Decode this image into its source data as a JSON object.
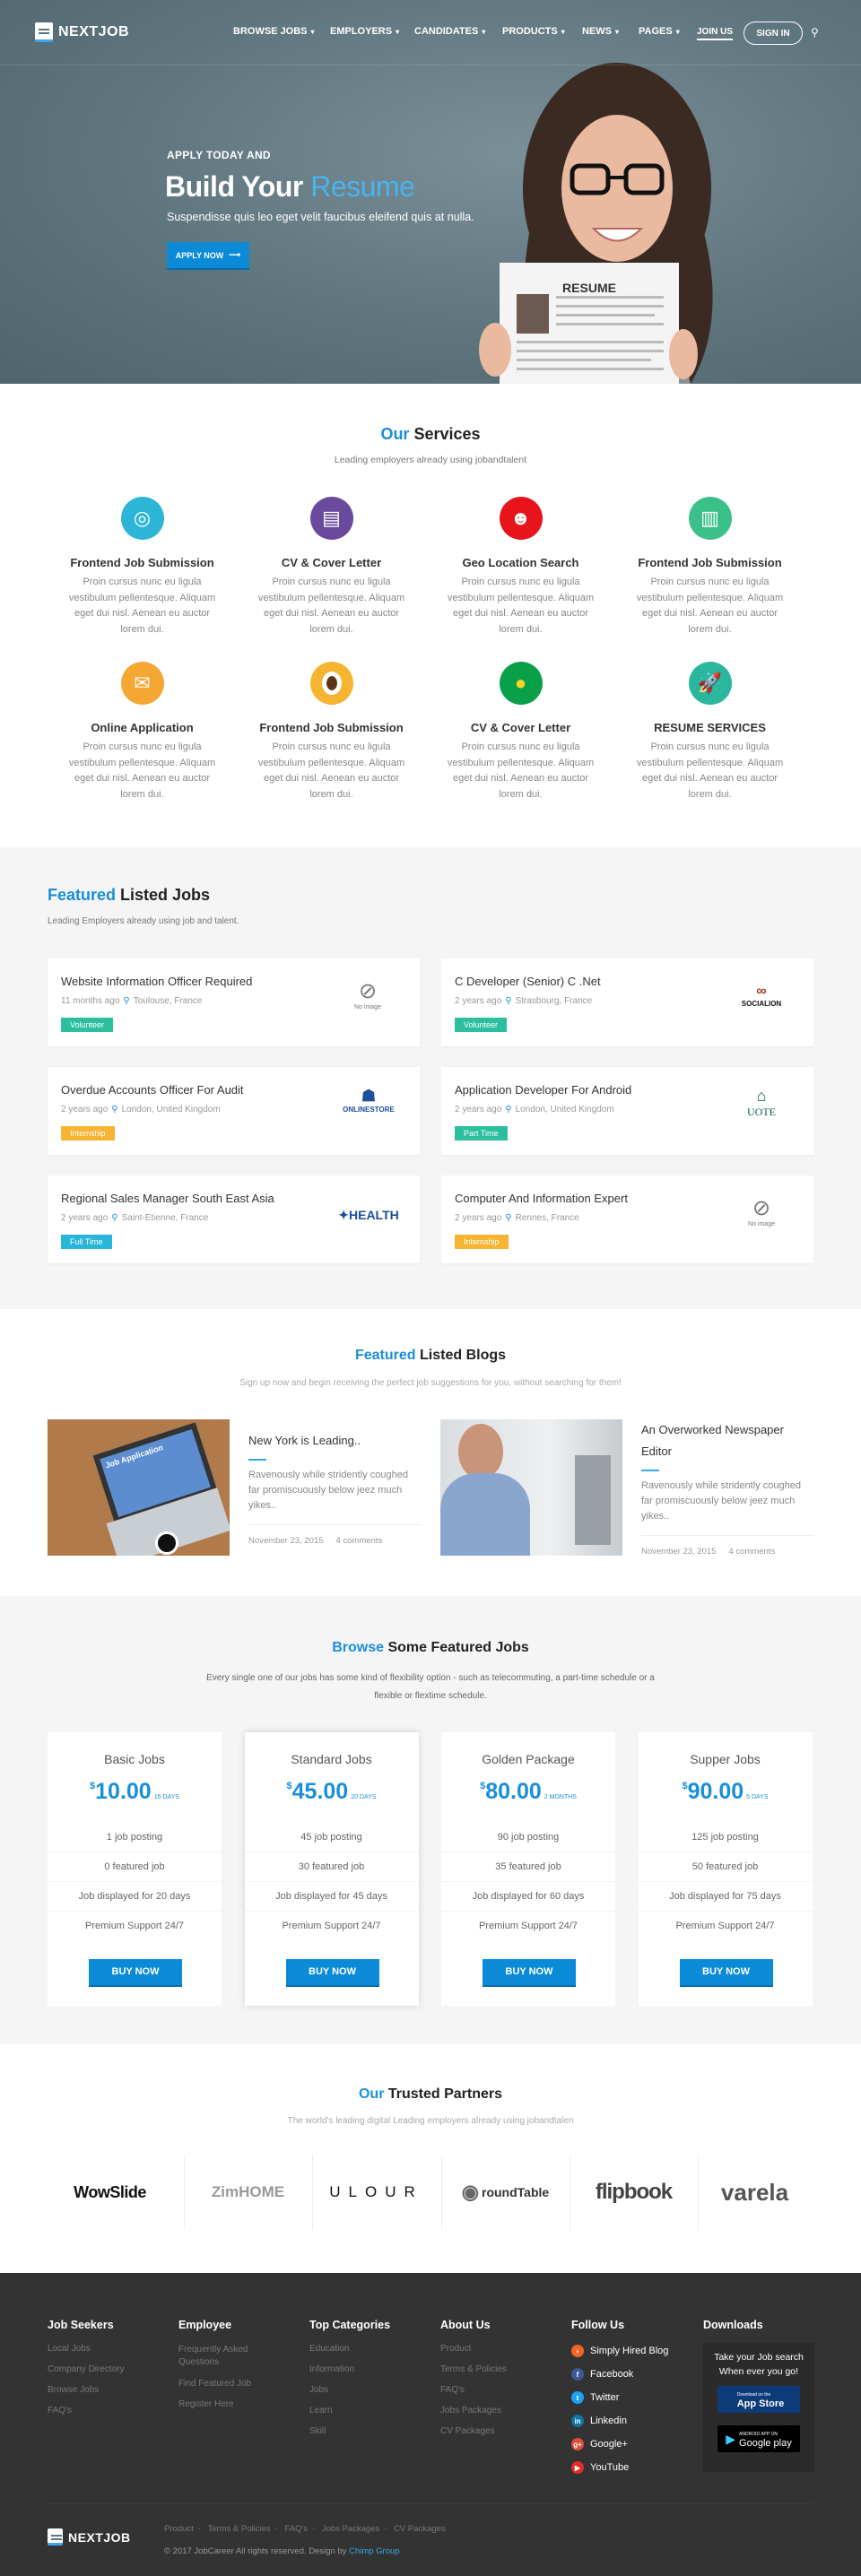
{
  "colors": {
    "accent": "#1a8fd9",
    "button": "#0b8ad8",
    "footer_bg": "#333333",
    "section_grey": "#f5f5f5"
  },
  "header": {
    "logo": "NEXTJOB",
    "nav": [
      {
        "label": "BROWSE JOBS"
      },
      {
        "label": "EMPLOYERS"
      },
      {
        "label": "CANDIDATES"
      },
      {
        "label": "PRODUCTS"
      },
      {
        "label": "NEWS"
      },
      {
        "label": "PAGES"
      }
    ],
    "join_us": "JOIN US",
    "sign_in": "SIGN IN",
    "search_icon": "search-icon"
  },
  "hero": {
    "kicker": "APPLY TODAY AND",
    "title_plain": "Build Your",
    "title_accent": "Resume",
    "subtitle": "Suspendisse quis leo eget velit faucibus eleifend quis at nulla.",
    "button": "APPLY NOW",
    "resume_label": "RESUME"
  },
  "services": {
    "title_accent": "Our",
    "title_rest": "Services",
    "subtitle": "Leading employers already using jobandtalent",
    "items": [
      {
        "name": "Frontend Job Submission",
        "text": "Proin cursus nunc eu ligula vestibulum pellentesque. Aliquam eget dui nisl. Aenean eu auctor lorem dui.",
        "icon": "target-icon",
        "color": "#2cb5d7"
      },
      {
        "name": "CV & Cover Letter",
        "text": "Proin cursus nunc eu ligula vestibulum pellentesque. Aliquam eget dui nisl. Aenean eu auctor lorem dui.",
        "icon": "chart-document-icon",
        "color": "#6a4a9c"
      },
      {
        "name": "Geo Location Search",
        "text": "Proin cursus nunc eu ligula vestibulum pellentesque. Aliquam eget dui nisl. Aenean eu auctor lorem dui.",
        "icon": "businessman-icon",
        "color": "#e8141b"
      },
      {
        "name": "Frontend Job Submission",
        "text": "Proin cursus nunc eu ligula vestibulum pellentesque. Aliquam eget dui nisl. Aenean eu auctor lorem dui.",
        "icon": "binders-icon",
        "color": "#3cc08a"
      },
      {
        "name": "Online Application",
        "text": "Proin cursus nunc eu ligula vestibulum pellentesque. Aliquam eget dui nisl. Aenean eu auctor lorem dui.",
        "icon": "envelope-icon",
        "color": "#f5a733"
      },
      {
        "name": "Frontend Job Submission",
        "text": "Proin cursus nunc eu ligula vestibulum pellentesque. Aliquam eget dui nisl. Aenean eu auctor lorem dui.",
        "icon": "coffee-icon",
        "color": "#f6b531"
      },
      {
        "name": "CV & Cover Letter",
        "text": "Proin cursus nunc eu ligula vestibulum pellentesque. Aliquam eget dui nisl. Aenean eu auctor lorem dui.",
        "icon": "lightbulb-icon",
        "color": "#0aa04a"
      },
      {
        "name": "RESUME SERVICES",
        "text": "Proin cursus nunc eu ligula vestibulum pellentesque. Aliquam eget dui nisl. Aenean eu auctor lorem dui.",
        "icon": "rocket-icon",
        "color": "#2bb69e"
      }
    ]
  },
  "jobs": {
    "title_accent": "Featured",
    "title_rest": "Listed Jobs",
    "subtitle": "Leading Employers already using job and talent.",
    "items": [
      {
        "title": "Website Information Officer Required",
        "age": "11 months ago",
        "location": "Toulouse, France",
        "type": "Volunteer",
        "type_color": "#2bbf9e",
        "logo": "No image"
      },
      {
        "title": "C Developer (Senior) C .Net",
        "age": "2 years ago",
        "location": "Strasbourg, France",
        "type": "Volunteer",
        "type_color": "#2bbf9e",
        "logo": "SOCIALION"
      },
      {
        "title": "Overdue Accounts Officer For Audit",
        "age": "2 years ago",
        "location": "London, United Kingdom",
        "type": "Internship",
        "type_color": "#f5b431",
        "logo": "ONLINESTORE"
      },
      {
        "title": "Application Developer For Android",
        "age": "2 years ago",
        "location": "London, United Kingdom",
        "type": "Part Time",
        "type_color": "#2bbf9e",
        "logo": "UOTE"
      },
      {
        "title": "Regional Sales Manager South East Asia",
        "age": "2 years ago",
        "location": "Saint-Etienne, France",
        "type": "Full Time",
        "type_color": "#28b6d8",
        "logo": "HEALTH"
      },
      {
        "title": "Computer And Information Expert",
        "age": "2 years ago",
        "location": "Rennes, France",
        "type": "Internship",
        "type_color": "#f5b431",
        "logo": "No image"
      }
    ]
  },
  "blogs": {
    "title_accent": "Featured",
    "title_rest": "Listed Blogs",
    "subtitle": "Sign up now and begin receiving the perfect job suggestions for you, without searching for them!",
    "items": [
      {
        "title": "New York is Leading..",
        "excerpt": "Ravenously while stridently coughed far promiscuously below jeez much yikes..",
        "date": "November 23, 2015",
        "comments": "4 comments",
        "image_text": "Job Application"
      },
      {
        "title": "An Overworked Newspaper Editor",
        "excerpt": "Ravenously while stridently coughed far promiscuously below jeez much yikes..",
        "date": "November 23, 2015",
        "comments": "4 comments"
      }
    ]
  },
  "pricing": {
    "title_accent": "Browse",
    "title_rest": "Some Featured Jobs",
    "subtitle": "Every single one of our jobs has some kind of flexibility option - such as telecommuting, a part-time schedule or a flexible or flextime schedule.",
    "plans": [
      {
        "name": "Basic Jobs",
        "currency": "$",
        "price": "10.00",
        "period": "15 DAYS",
        "features": [
          "1 job posting",
          "0 featured job",
          "Job displayed for 20 days",
          "Premium Support 24/7"
        ],
        "button": "BUY NOW"
      },
      {
        "name": "Standard Jobs",
        "currency": "$",
        "price": "45.00",
        "period": "20 DAYS",
        "features": [
          "45 job posting",
          "30 featured job",
          "Job displayed for 45 days",
          "Premium Support 24/7"
        ],
        "button": "BUY NOW"
      },
      {
        "name": "Golden Package",
        "currency": "$",
        "price": "80.00",
        "period": "2 MONTHS",
        "features": [
          "90 job posting",
          "35 featured job",
          "Job displayed for 60 days",
          "Premium Support 24/7"
        ],
        "button": "BUY NOW"
      },
      {
        "name": "Supper Jobs",
        "currency": "$",
        "price": "90.00",
        "period": "5 DAYS",
        "features": [
          "125 job posting",
          "50 featured job",
          "Job displayed for 75 days",
          "Premium Support 24/7"
        ],
        "button": "BUY NOW"
      }
    ]
  },
  "partners": {
    "title_accent": "Our",
    "title_rest": "Trusted Partners",
    "subtitle": "The world's leading digital Leading employers already using jobandtalen",
    "logos": [
      "WowSlide",
      "ZimHOME",
      "ULOUR",
      "roundTable",
      "flipbook",
      "varela"
    ]
  },
  "footer": {
    "columns": [
      {
        "heading": "Job Seekers",
        "links": [
          "Local Jobs",
          "Company Directory",
          "Browse Jobs",
          "FAQ's"
        ]
      },
      {
        "heading": "Employee",
        "links": [
          "Frequently Asked Questions",
          "Find Featured Job",
          "Register Here"
        ]
      },
      {
        "heading": "Top Categories",
        "links": [
          "Education",
          "Information",
          "Jobs",
          "Learn",
          "Skill"
        ]
      },
      {
        "heading": "About Us",
        "links": [
          "Product",
          "Terms & Policies",
          "FAQ's",
          "Jobs Packages",
          "CV Packages"
        ]
      }
    ],
    "follow": {
      "heading": "Follow Us",
      "items": [
        {
          "label": "Simply Hired Blog",
          "icon": "rss-icon",
          "color": "#f26522"
        },
        {
          "label": "Facebook",
          "icon": "facebook-icon",
          "color": "#3b5998"
        },
        {
          "label": "Twitter",
          "icon": "twitter-icon",
          "color": "#1da1f2"
        },
        {
          "label": "Linkedin",
          "icon": "linkedin-icon",
          "color": "#0e76a8"
        },
        {
          "label": "Google+",
          "icon": "google-plus-icon",
          "color": "#dd4b39"
        },
        {
          "label": "YouTube",
          "icon": "youtube-icon",
          "color": "#e52d27"
        }
      ]
    },
    "downloads": {
      "heading": "Downloads",
      "text1": "Take your Job search",
      "text2": "When ever you go!",
      "app_store_small": "Download on the",
      "app_store": "App Store",
      "google_play_small": "ANDROID APP ON",
      "google_play": "Google play"
    },
    "logo": "NEXTJOB",
    "bottom_links": [
      "Product",
      "Terms & Policies",
      "FAQ's",
      "Jobs Packages",
      "CV Packages"
    ],
    "copyright": "© 2017 JobCareer All rights reserved. Design by",
    "designer": "Chimp Group"
  }
}
